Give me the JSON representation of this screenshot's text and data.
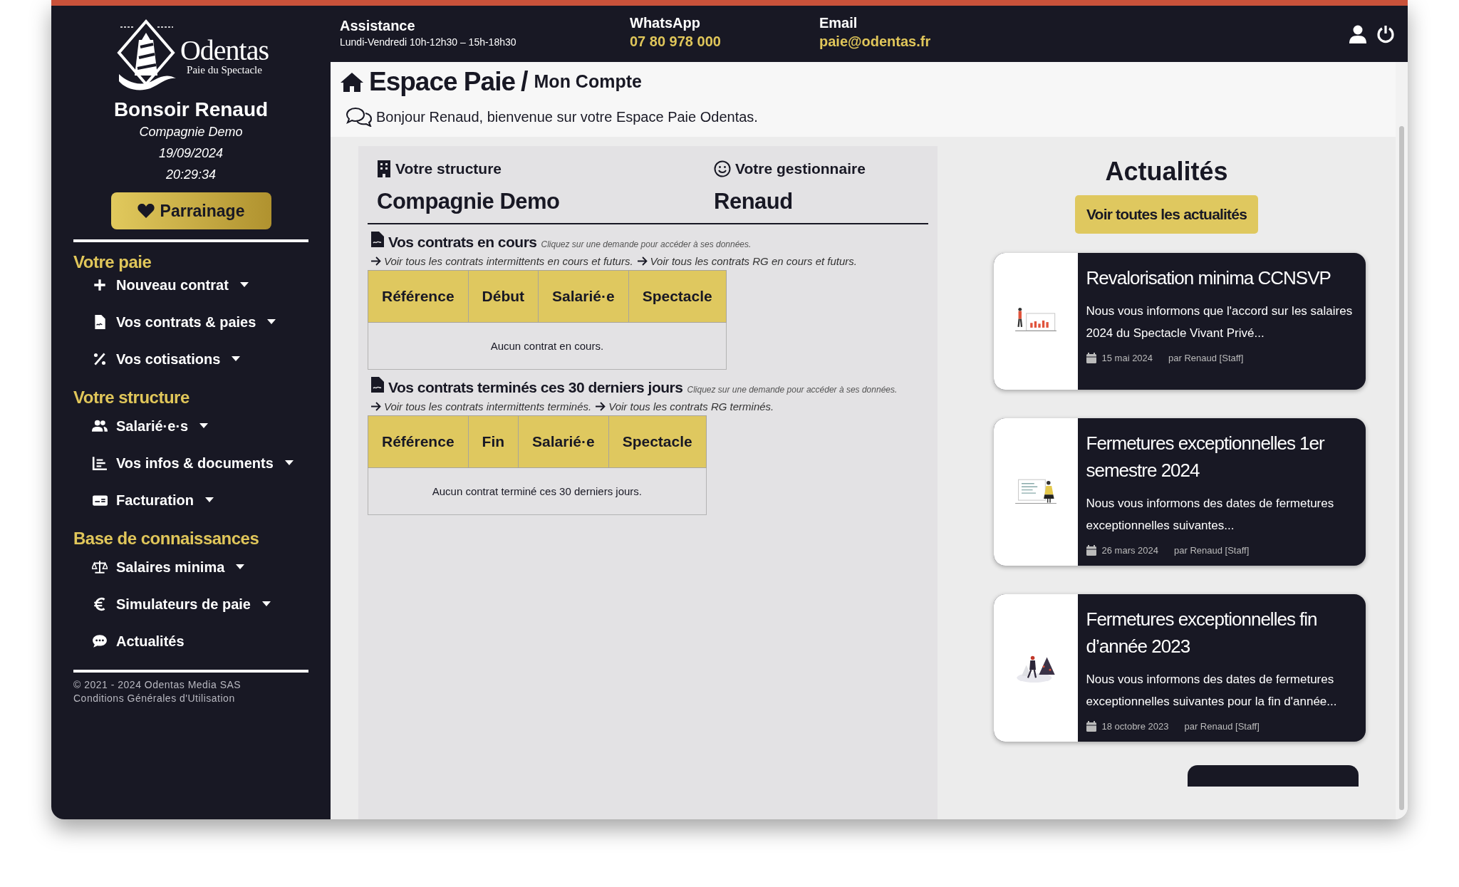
{
  "sidebar": {
    "logo": {
      "name": "Odentas",
      "tagline": "Paie du Spectacle"
    },
    "greeting": "Bonsoir Renaud",
    "company": "Compagnie Demo",
    "date": "19/09/2024",
    "time": "20:29:34",
    "referral_button": "Parrainage",
    "sections": [
      {
        "title": "Votre paie",
        "items": [
          {
            "label": "Nouveau contrat",
            "dropdown": true
          },
          {
            "label": "Vos contrats & paies",
            "dropdown": true
          },
          {
            "label": "Vos cotisations",
            "dropdown": true
          }
        ]
      },
      {
        "title": "Votre structure",
        "items": [
          {
            "label": "Salarié·e·s",
            "dropdown": true
          },
          {
            "label": "Vos infos & documents",
            "dropdown": true
          },
          {
            "label": "Facturation",
            "dropdown": true
          }
        ]
      },
      {
        "title": "Base de connaissances",
        "items": [
          {
            "label": "Salaires minima",
            "dropdown": true
          },
          {
            "label": "Simulateurs de paie",
            "dropdown": true
          },
          {
            "label": "Actualités",
            "dropdown": false
          }
        ]
      }
    ],
    "footer": {
      "copyright": "© 2021 - 2024 Odentas Media SAS",
      "terms_link": "Conditions Générales d'Utilisation"
    }
  },
  "top_bar": {
    "contacts": [
      {
        "label": "Assistance",
        "value": "Lundi-Vendredi 10h-12h30 – 15h-18h30",
        "kind": "plain"
      },
      {
        "label": "WhatsApp",
        "value": "07 80 978 000",
        "kind": "highlight"
      },
      {
        "label": "Email",
        "value": "paie@odentas.fr",
        "kind": "highlight"
      }
    ]
  },
  "page_header": {
    "title": "Espace Paie",
    "separator": "/",
    "subtitle": "Mon Compte",
    "welcome": "Bonjour Renaud, bienvenue sur votre Espace Paie Odentas."
  },
  "summary": {
    "structure_label": "Votre structure",
    "structure_value": "Compagnie Demo",
    "manager_label": "Votre gestionnaire",
    "manager_value": "Renaud"
  },
  "contract_sections": [
    {
      "title": "Vos contrats en cours",
      "hint": "Cliquez sur une demande pour accéder à ses données.",
      "links": [
        "Voir tous les contrats intermittents en cours et futurs.",
        "Voir tous les contrats RG en cours et futurs."
      ],
      "columns": [
        "Référence",
        "Début",
        "Salarié·e",
        "Spectacle"
      ],
      "empty_message": "Aucun contrat en cours."
    },
    {
      "title": "Vos contrats terminés ces 30 derniers jours",
      "hint": "Cliquez sur une demande pour accéder à ses données.",
      "links": [
        "Voir tous les contrats intermittents terminés.",
        "Voir tous les contrats RG terminés."
      ],
      "columns": [
        "Référence",
        "Fin",
        "Salarié·e",
        "Spectacle"
      ],
      "empty_message": "Aucun contrat terminé ces 30 derniers jours."
    }
  ],
  "news": {
    "title": "Actualités",
    "all_button": "Voir toutes les actualités",
    "cards": [
      {
        "title": "Revalorisation minima CCNSVP",
        "excerpt": "Nous vous informons que l'accord sur les salaires 2024 du Spectacle Vivant Privé...",
        "date": "15 mai 2024",
        "author": "par Renaud [Staff]"
      },
      {
        "title": "Fermetures exceptionnelles 1er semestre 2024",
        "excerpt": "Nous vous informons des dates de fermetures exceptionnelles suivantes...",
        "date": "26 mars 2024",
        "author": "par Renaud [Staff]"
      },
      {
        "title": "Fermetures exceptionnelles fin d’année 2023",
        "excerpt": "Nous vous informons des dates de fermetures exceptionnelles suivantes pour la fin d'année...",
        "date": "18 octobre 2023",
        "author": "par Renaud [Staff]"
      }
    ]
  }
}
